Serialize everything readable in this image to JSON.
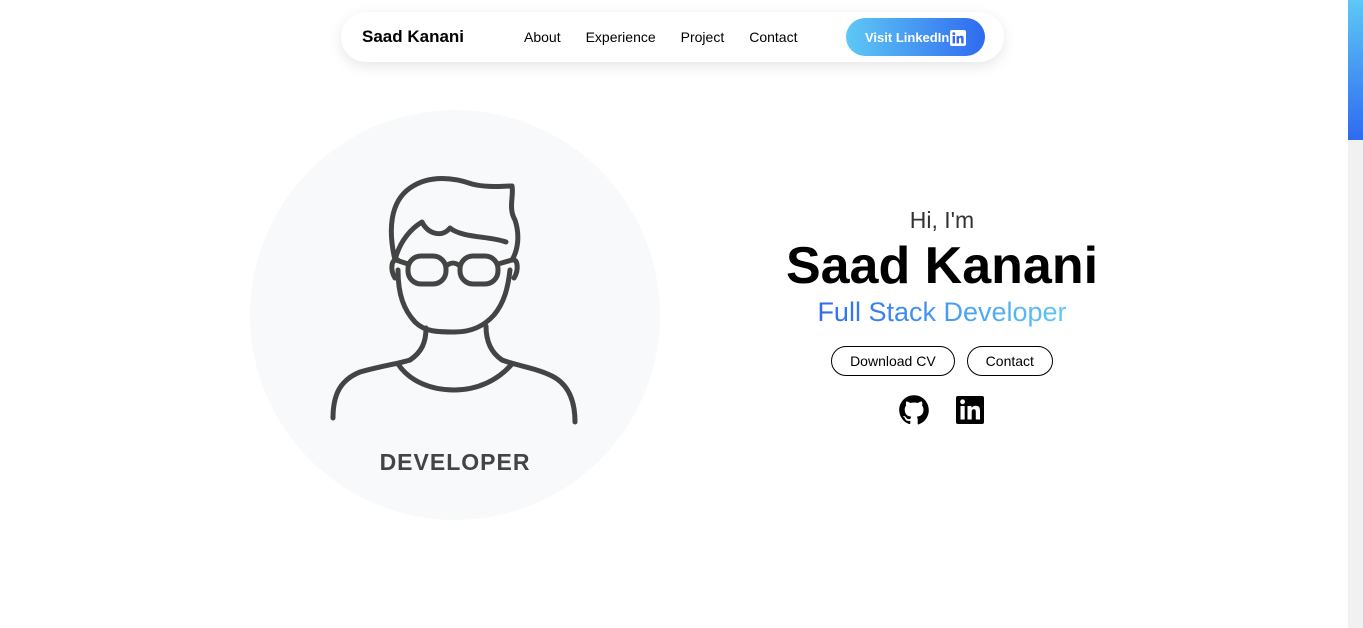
{
  "navbar": {
    "brand": "Saad Kanani",
    "links": [
      "About",
      "Experience",
      "Project",
      "Contact"
    ],
    "cta_label": "Visit LinkedIn",
    "cta_icon": "linkedin-icon"
  },
  "avatar": {
    "caption": "DEVELOPER",
    "icon": "developer-avatar-icon"
  },
  "hero": {
    "greeting": "Hi, I'm",
    "name": "Saad Kanani",
    "role": "Full Stack Developer",
    "buttons": {
      "download_cv": "Download CV",
      "contact": "Contact"
    },
    "socials": [
      "github-icon",
      "linkedin-icon"
    ]
  },
  "colors": {
    "accent_start": "#5ec8f5",
    "accent_end": "#2f6af0",
    "avatar_bg": "#f8f9fa",
    "avatar_stroke": "#444444"
  }
}
